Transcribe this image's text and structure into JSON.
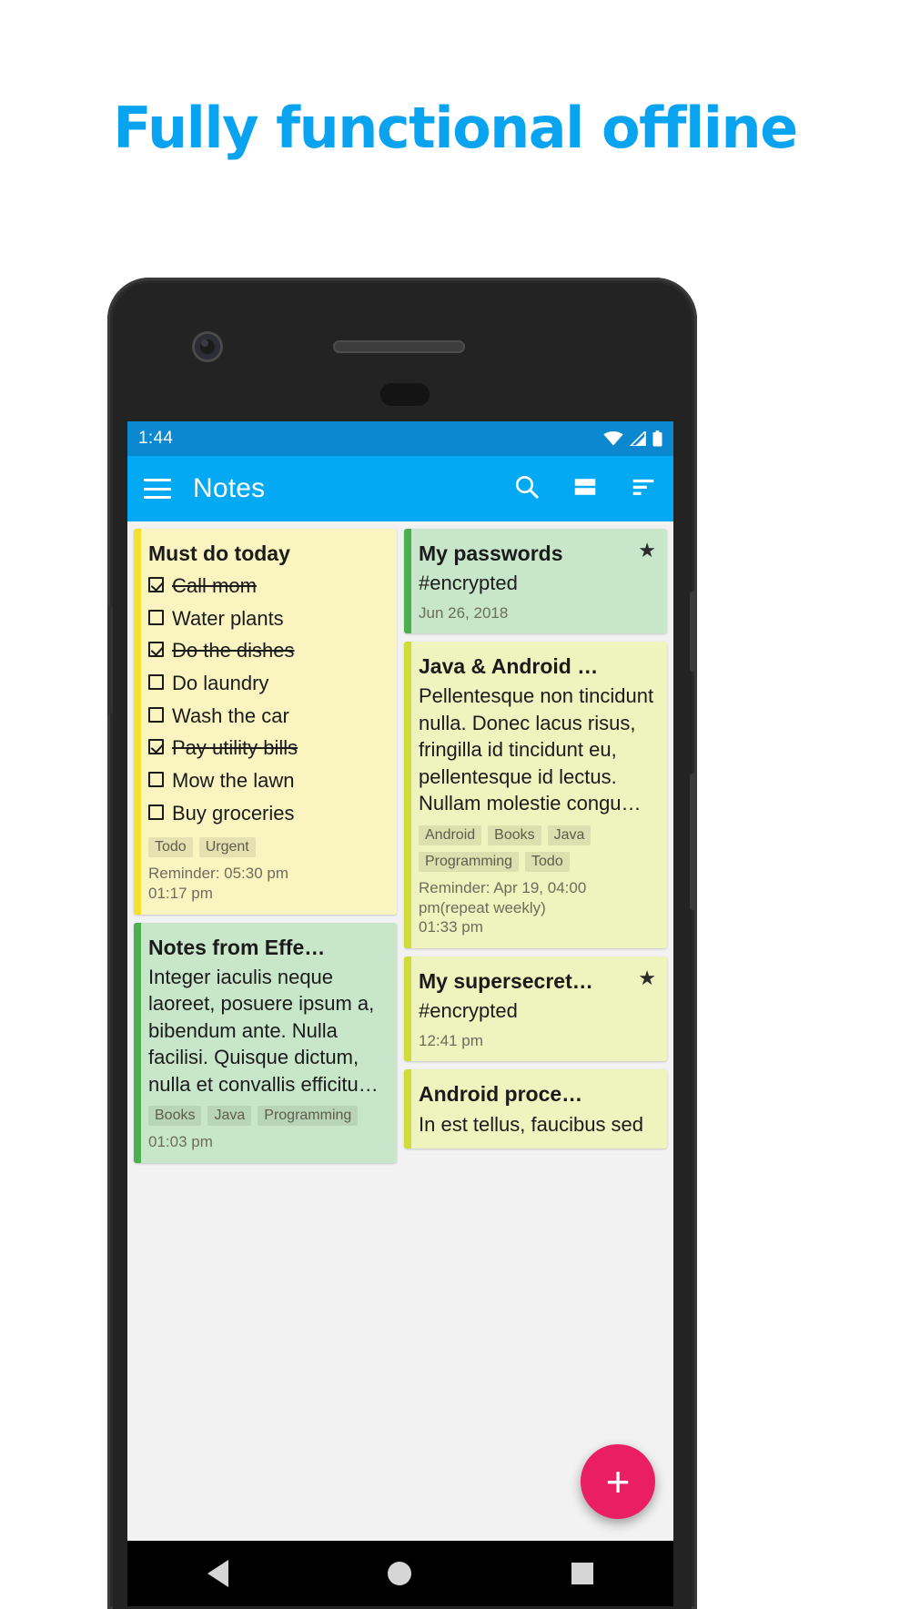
{
  "headline": "Fully functional offline",
  "colors": {
    "accent_blue": "#0aa3f0",
    "appbar_blue": "#04a9f4",
    "statusbar_blue": "#0b88cf",
    "fab_pink": "#e91e63",
    "yellow_card": "#faf5c0",
    "yellow_stripe": "#f5e12a",
    "green_card": "#c8e6c9",
    "green_stripe": "#4caf50",
    "lime_card": "#eff3bd",
    "lime_stripe": "#cddc39"
  },
  "statusbar": {
    "time": "1:44",
    "icons": [
      "wifi-icon",
      "signal-icon",
      "battery-icon"
    ]
  },
  "appbar": {
    "menu_icon": "hamburger-menu-icon",
    "title": "Notes",
    "actions": [
      {
        "name": "search-icon",
        "label": "Search"
      },
      {
        "name": "view-mode-icon",
        "label": "View mode"
      },
      {
        "name": "sort-icon",
        "label": "Sort"
      }
    ]
  },
  "fab": {
    "label": "+",
    "name": "add-note-fab"
  },
  "navbar": {
    "back": "back-triangle-icon",
    "home": "home-circle-icon",
    "recents": "recents-square-icon"
  },
  "notes": {
    "left_column": [
      {
        "id": "must-do-today",
        "type": "checklist",
        "title": "Must do today",
        "color": "yellow",
        "starred": false,
        "items": [
          {
            "text": "Call mom",
            "checked": true
          },
          {
            "text": "Water plants",
            "checked": false
          },
          {
            "text": "Do the dishes",
            "checked": true
          },
          {
            "text": "Do laundry",
            "checked": false
          },
          {
            "text": "Wash the car",
            "checked": false
          },
          {
            "text": "Pay utility bills",
            "checked": true
          },
          {
            "text": "Mow the lawn",
            "checked": false
          },
          {
            "text": "Buy groceries",
            "checked": false
          }
        ],
        "tags": [
          "Todo",
          "Urgent"
        ],
        "reminder": "Reminder: 05:30 pm",
        "time": "01:17 pm"
      },
      {
        "id": "notes-from-effe",
        "type": "text",
        "title": "Notes from Effe…",
        "color": "green",
        "starred": false,
        "body": "Integer iaculis neque laoreet, posuere ipsum a, bibendum ante. Nulla facilisi. Quisque dictum, nulla et convallis efficitu…",
        "tags": [
          "Books",
          "Java",
          "Programming"
        ],
        "reminder": "",
        "time": "01:03 pm"
      }
    ],
    "right_column": [
      {
        "id": "my-passwords",
        "type": "text",
        "title": "My passwords",
        "color": "green",
        "starred": true,
        "body": "#encrypted",
        "tags": [],
        "reminder": "",
        "time": "Jun 26, 2018"
      },
      {
        "id": "java-and-android",
        "type": "text",
        "title": "Java & Android …",
        "color": "lime",
        "starred": false,
        "body": "Pellentesque non tincidunt nulla. Donec lacus risus, fringilla id tincidunt eu, pellentesque id lectus. Nullam molestie congu…",
        "tags": [
          "Android",
          "Books",
          "Java",
          "Programming",
          "Todo"
        ],
        "reminder": "Reminder: Apr 19, 04:00 pm(repeat weekly)",
        "time": "01:33 pm"
      },
      {
        "id": "my-supersecret",
        "type": "text",
        "title": "My supersecret…",
        "color": "lime",
        "starred": true,
        "body": "#encrypted",
        "tags": [],
        "reminder": "",
        "time": "12:41 pm"
      },
      {
        "id": "android-proce",
        "type": "text",
        "title": "Android proce…",
        "color": "lime",
        "starred": false,
        "body": "In est tellus, faucibus sed",
        "tags": [],
        "reminder": "",
        "time": ""
      }
    ]
  }
}
